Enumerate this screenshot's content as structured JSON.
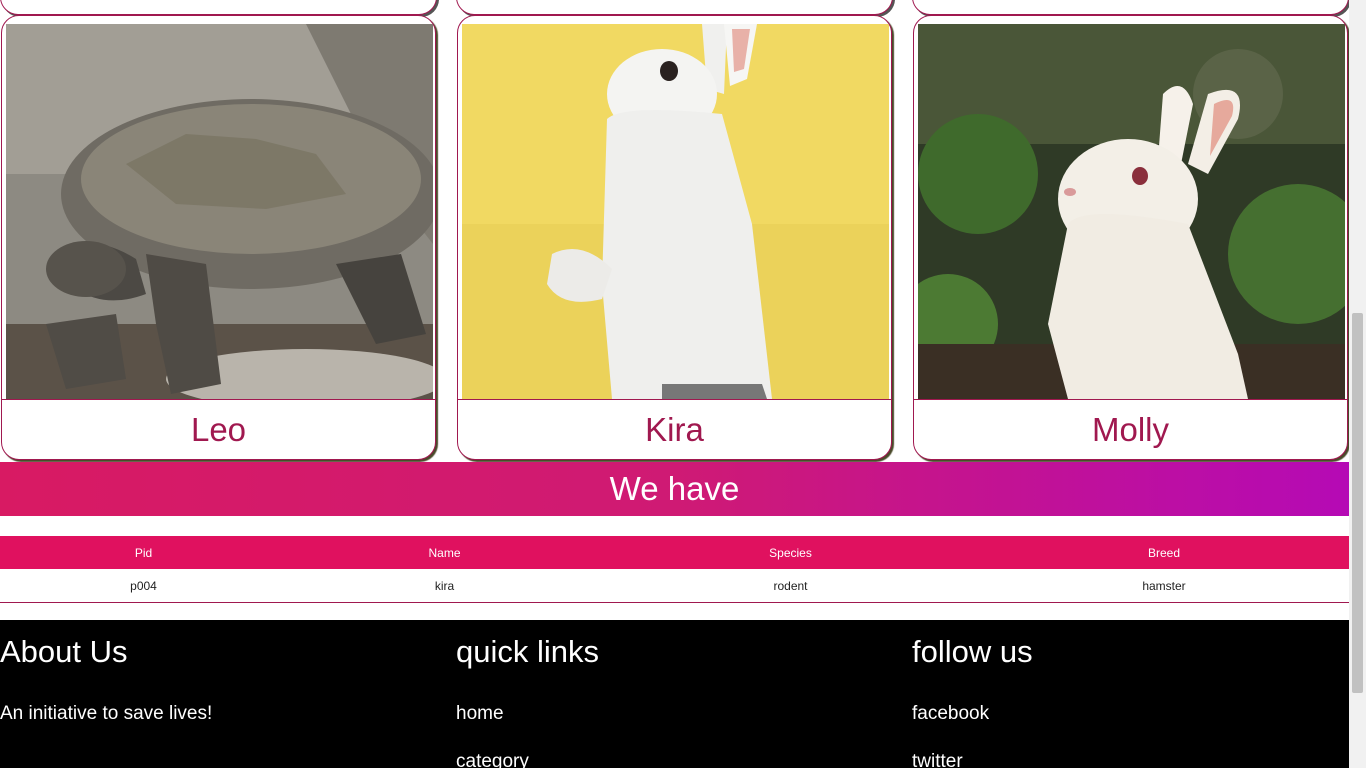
{
  "cards": [
    {
      "name": "Leo"
    },
    {
      "name": "Kira"
    },
    {
      "name": "Molly"
    }
  ],
  "section": {
    "title": "We have"
  },
  "table": {
    "headers": [
      "Pid",
      "Name",
      "Species",
      "Breed"
    ],
    "rows": [
      [
        "p004",
        "kira",
        "rodent",
        "hamster"
      ]
    ]
  },
  "footer": {
    "about": {
      "title": "About Us",
      "text": "An initiative to save lives!"
    },
    "quick_links": {
      "title": "quick links",
      "items": [
        "home",
        "category"
      ]
    },
    "follow": {
      "title": "follow us",
      "items": [
        "facebook",
        "twitter"
      ]
    }
  },
  "colors": {
    "accent": "#a0184f",
    "header_pink": "#e0115f",
    "gradient_end": "#b50ab5"
  }
}
